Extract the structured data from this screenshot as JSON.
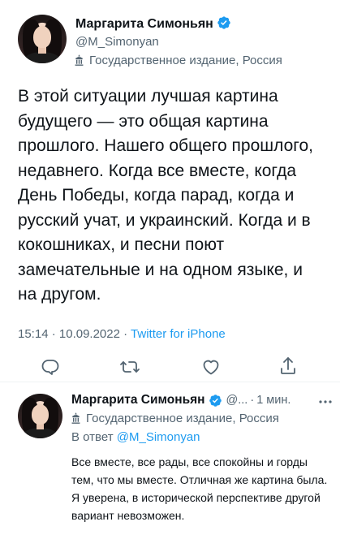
{
  "main_tweet": {
    "author_name": "Маргарита Симоньян",
    "handle": "@M_Simonyan",
    "label": "Государственное издание, Россия",
    "text": "В этой ситуации лучшая картина будущего — это общая картина прошлого. Нашего общего прошлого, недавнего. Когда все вместе, когда День Победы, когда парад, когда и русский учат, и украинский. Когда и в кокошниках, и песни поют замечательные и на одном языке, и на другом.",
    "time": "15:14",
    "date": "10.09.2022",
    "source": "Twitter for iPhone",
    "separator": "·"
  },
  "reply_tweet": {
    "author_name": "Маргарита Симоньян",
    "handle": "@...",
    "time_ago": "1 мин.",
    "separator": "·",
    "label": "Государственное издание, Россия",
    "reply_prefix": "В ответ",
    "reply_mention": "@M_Simonyan",
    "text": "Все вместе, все рады, все спокойны и горды тем, что мы вместе. Отличная же картина была. Я уверена, в исторической перспективе другой вариант невозможен."
  },
  "icons": {
    "verified": "verified-badge-icon",
    "label": "government-building-icon",
    "reply": "comment-icon",
    "retweet": "retweet-icon",
    "like": "heart-icon",
    "share": "share-icon",
    "more": "more-icon"
  },
  "colors": {
    "accent": "#1d9bf0",
    "secondary_text": "#536471",
    "primary_text": "#0f1419"
  }
}
